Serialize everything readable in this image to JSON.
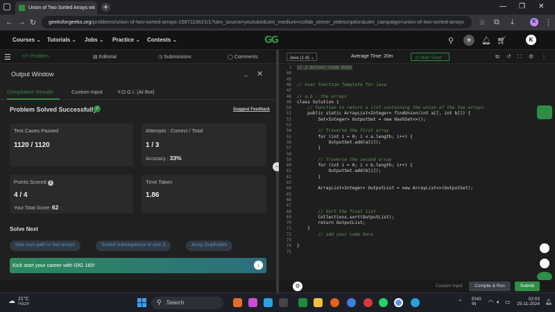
{
  "browser": {
    "tab_title": "Union of Two Sorted Arrays wit",
    "new_tab": "+",
    "url_domain": "geeksforgeeks.org",
    "url_path": "/problems/union-of-two-sorted-arrays-1587115621/1?utm_source=youtube&utm_medium=collab_striver_ytdescription&utm_campaign=union-of-two-sorted-arrays",
    "profile_initial": "K"
  },
  "header": {
    "menus": [
      "Courses",
      "Tutorials",
      "Jobs",
      "Practice",
      "Contests"
    ],
    "logo": "GG",
    "avatar": "K"
  },
  "problem_tabs": [
    "Problem",
    "Editorial",
    "Submissions",
    "Comments"
  ],
  "output": {
    "title": "Output Window",
    "tabs": [
      "Compilation Results",
      "Custom Input",
      "Y.O.G.I. (AI Bot)"
    ],
    "status": "Problem Solved Successfully",
    "suggest": "Suggest Feedback",
    "test_cases_label": "Test Cases Passed",
    "test_cases_value": "1120 / 1120",
    "attempts_label": "Attempts : Correct / Total",
    "attempts_value": "1 / 3",
    "accuracy_label": "Accuracy :",
    "accuracy_value": "33%",
    "points_label": "Points Scored",
    "points_value": "4 / 4",
    "total_score_label": "Your Total Score:",
    "total_score_value": "62",
    "time_label": "Time Taken",
    "time_value": "1.86",
    "solve_next": "Solve Next",
    "suggestions": [
      "Max sum path in two arrays",
      "Sorted subsequence of size 3",
      "Array Duplicates"
    ],
    "banner": "Kick start your career with GfG 160!"
  },
  "editor": {
    "language": "Java (1.8)",
    "avg_time": "Average Time: 20m",
    "start_timer": "Start Timer",
    "custom_input": "Custom Input",
    "compile_run": "Compile & Run",
    "submit": "Submit",
    "lines": [
      {
        "n": "1",
        "t": "// } Driver Code Ends",
        "c": "cm"
      },
      {
        "n": "44",
        "t": "",
        "c": ""
      },
      {
        "n": "45",
        "t": "",
        "c": ""
      },
      {
        "n": "46",
        "t": "// User function Template for Java",
        "c": "cm"
      },
      {
        "n": "47",
        "t": "",
        "c": ""
      },
      {
        "n": "48",
        "t": "// a,b : the arrays",
        "c": "cm"
      },
      {
        "n": "49",
        "t": "class Solution {",
        "c": ""
      },
      {
        "n": "50",
        "t": "    // Function to return a list containing the union of the two arrays.",
        "c": "cm"
      },
      {
        "n": "51",
        "t": "    public static ArrayList<Integer> findUnion(int a[], int b[]) {",
        "c": ""
      },
      {
        "n": "52",
        "t": "        Set<Integer> OutputSet = new HashSet<>();",
        "c": ""
      },
      {
        "n": "53",
        "t": "",
        "c": ""
      },
      {
        "n": "54",
        "t": "        // Traverse the first array",
        "c": "cm"
      },
      {
        "n": "55",
        "t": "        for (int i = 0; i < a.length; i++) {",
        "c": ""
      },
      {
        "n": "56",
        "t": "            OutputSet.add(a[i]);",
        "c": ""
      },
      {
        "n": "57",
        "t": "        }",
        "c": ""
      },
      {
        "n": "58",
        "t": "",
        "c": ""
      },
      {
        "n": "59",
        "t": "        // Traverse the second array",
        "c": "cm"
      },
      {
        "n": "60",
        "t": "        for (int i = 0; i < b.length; i++) {",
        "c": ""
      },
      {
        "n": "61",
        "t": "            OutputSet.add(b[i]);",
        "c": ""
      },
      {
        "n": "62",
        "t": "        }",
        "c": ""
      },
      {
        "n": "63",
        "t": "",
        "c": ""
      },
      {
        "n": "64",
        "t": "        ArrayList<Integer> OutputList = new ArrayList<>(OutputSet);",
        "c": ""
      },
      {
        "n": "65",
        "t": "",
        "c": ""
      },
      {
        "n": "66",
        "t": "",
        "c": ""
      },
      {
        "n": "67",
        "t": "",
        "c": ""
      },
      {
        "n": "68",
        "t": "        // Sort the final list",
        "c": "cm"
      },
      {
        "n": "69",
        "t": "        Collections.sort(OutputList);",
        "c": ""
      },
      {
        "n": "70",
        "t": "        return OutputList;",
        "c": ""
      },
      {
        "n": "71",
        "t": "    }",
        "c": ""
      },
      {
        "n": "72",
        "t": "        // add your code here",
        "c": "cm"
      },
      {
        "n": "73",
        "t": "",
        "c": ""
      },
      {
        "n": "74",
        "t": "}",
        "c": ""
      },
      {
        "n": "75",
        "t": "",
        "c": ""
      }
    ]
  },
  "taskbar": {
    "temp": "21°C",
    "weather": "Haze",
    "search": "Search",
    "lang": "ENG",
    "region": "IN",
    "time": "02:03",
    "date": "25-11-2024"
  },
  "colors": {
    "accent": "#2f8d46",
    "link": "#5a8bc6"
  }
}
